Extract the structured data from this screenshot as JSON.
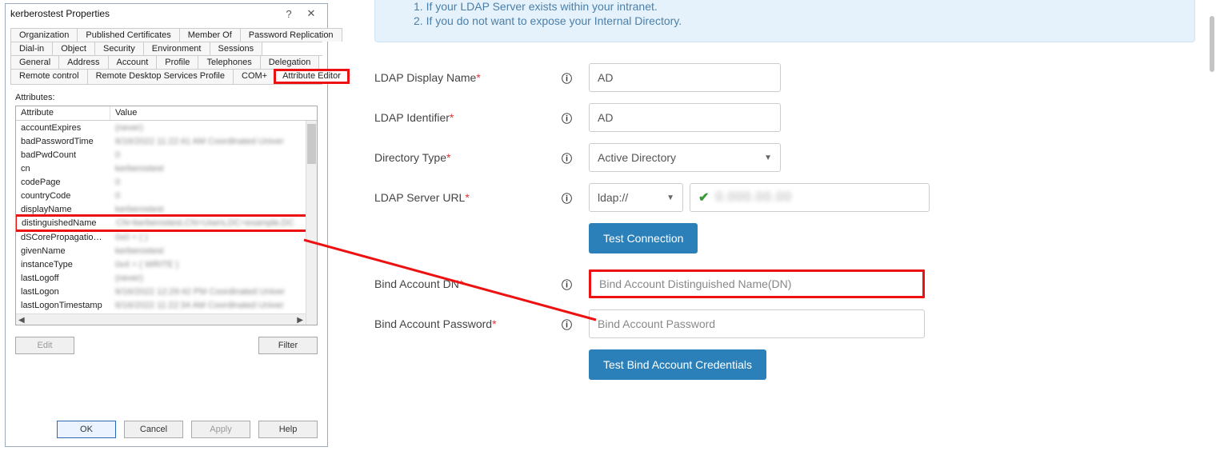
{
  "dialog": {
    "title": "kerberostest Properties",
    "help_btn": "?",
    "close_btn": "✕",
    "tabs_row1": [
      "Organization",
      "Published Certificates",
      "Member Of",
      "Password Replication"
    ],
    "tabs_row2": [
      "Dial-in",
      "Object",
      "Security",
      "Environment",
      "Sessions"
    ],
    "tabs_row3": [
      "General",
      "Address",
      "Account",
      "Profile",
      "Telephones",
      "Delegation"
    ],
    "tabs_row4": [
      "Remote control",
      "Remote Desktop Services Profile",
      "COM+",
      "Attribute Editor"
    ],
    "active_tab": "Attribute Editor",
    "attributes_label": "Attributes:",
    "list_header": {
      "col1": "Attribute",
      "col2": "Value"
    },
    "rows": [
      {
        "name": "accountExpires",
        "value": "(never)"
      },
      {
        "name": "badPasswordTime",
        "value": "6/16/2022 11:22:41 AM Coordinated Univer"
      },
      {
        "name": "badPwdCount",
        "value": "0"
      },
      {
        "name": "cn",
        "value": "kerberostest"
      },
      {
        "name": "codePage",
        "value": "0"
      },
      {
        "name": "countryCode",
        "value": "0"
      },
      {
        "name": "displayName",
        "value": "kerberostest"
      },
      {
        "name": "distinguishedName",
        "value": "CN=kerberostest,CN=Users,DC=example,DC"
      },
      {
        "name": "dSCorePropagationD...",
        "value": "0x0 = ( )"
      },
      {
        "name": "givenName",
        "value": "kerberostest"
      },
      {
        "name": "instanceType",
        "value": "0x4 = ( WRITE )"
      },
      {
        "name": "lastLogoff",
        "value": "(never)"
      },
      {
        "name": "lastLogon",
        "value": "6/16/2022 12:29:42 PM Coordinated Univer"
      },
      {
        "name": "lastLogonTimestamp",
        "value": "6/16/2022 11:22:34 AM Coordinated Univer"
      }
    ],
    "edit_btn": "Edit",
    "filter_btn": "Filter",
    "ok": "OK",
    "cancel": "Cancel",
    "apply": "Apply",
    "help": "Help"
  },
  "rightpane": {
    "info_line1_trunc": "1. If your LDAP Server exists within your intranet.",
    "info_line2": "2. If you do not want to expose your Internal Directory.",
    "fields": {
      "ldap_display_name": {
        "label": "LDAP Display Name",
        "value": "AD"
      },
      "ldap_identifier": {
        "label": "LDAP Identifier",
        "value": "AD"
      },
      "directory_type": {
        "label": "Directory Type",
        "selected": "Active Directory"
      },
      "ldap_server_url": {
        "label": "LDAP Server URL",
        "protocol": "ldap://",
        "host_masked": "0.000.00.00"
      },
      "bind_dn": {
        "label": "Bind Account DN",
        "placeholder": "Bind Account Distinguished Name(DN)"
      },
      "bind_pw": {
        "label": "Bind Account Password",
        "placeholder": "Bind Account Password"
      }
    },
    "buttons": {
      "test_conn": "Test Connection",
      "test_bind": "Test Bind Account Credentials"
    }
  },
  "colors": {
    "highlight": "#e11",
    "primary_blue": "#2b80b9",
    "info_bg": "#e6f2fb"
  }
}
